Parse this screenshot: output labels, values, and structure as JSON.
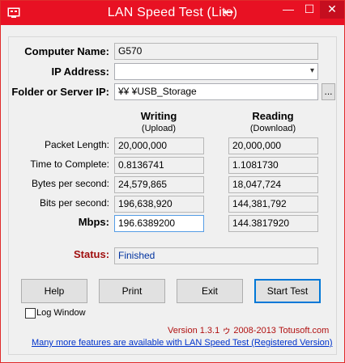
{
  "window": {
    "title": "LAN Speed Test (Lite)",
    "minimize": "—",
    "maximize": "☐",
    "close": "✕",
    "titlebar_color": "#e81123"
  },
  "form": {
    "computer_name_label": "Computer Name:",
    "computer_name_value": "G570",
    "ip_address_label": "IP Address:",
    "ip_address_value": "",
    "folder_label": "Folder or Server IP:",
    "folder_value": "¥¥                        ¥USB_Storage",
    "browse_label": "..."
  },
  "columns": {
    "writing_title": "Writing",
    "writing_sub": "(Upload)",
    "reading_title": "Reading",
    "reading_sub": "(Download)"
  },
  "rows": [
    {
      "label": "Packet Length:",
      "writing": "20,000,000",
      "reading": "20,000,000"
    },
    {
      "label": "Time to Complete:",
      "writing": "0.8136741",
      "reading": "1.1081730"
    },
    {
      "label": "Bytes per second:",
      "writing": "24,579,865",
      "reading": "18,047,724"
    },
    {
      "label": "Bits per second:",
      "writing": "196,638,920",
      "reading": "144,381,792"
    },
    {
      "label": "Mbps:",
      "writing": "196.6389200",
      "reading": "144.3817920"
    }
  ],
  "status": {
    "label": "Status:",
    "value": "Finished"
  },
  "buttons": {
    "help": "Help",
    "print": "Print",
    "exit": "Exit",
    "start": "Start Test"
  },
  "log_window_label": "Log Window",
  "version_text": "Version 1.3.1 ゥ 2008-2013 Totusoft.com",
  "promo_link": "Many more features are available with LAN Speed Test (Registered Version)"
}
